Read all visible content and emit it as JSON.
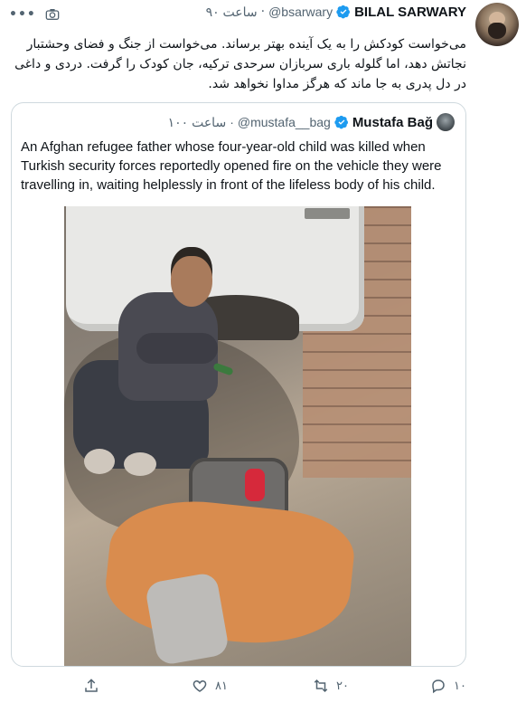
{
  "tweet": {
    "author_name": "BILAL SARWARY",
    "handle": "@bsarwary",
    "separator": "·",
    "time": "۹۰ ساعت",
    "text": "می‌خواست کودکش را به یک آینده بهتر برساند. می‌خواست از جنگ و فضای وحشتبار نجاتش دهد، اما گلوله باری سربازان سرحدی ترکیه، جان کودک را گرفت. دردی و داغی در دل پدری به جا ماند که هرگز مداوا نخواهد شد."
  },
  "quote": {
    "author_name": "Mustafa Bağ",
    "handle": "@mustafa__bag",
    "separator": "·",
    "time": "۱۰۰ ساعت",
    "text": "An Afghan refugee father whose four-year-old child was killed when Turkish security forces reportedly opened fire on the vehicle they were travelling in, waiting helplessly in front of the lifeless body of his child."
  },
  "actions": {
    "reply_count": "۱۰",
    "retweet_count": "۲۰",
    "like_count": "۸۱"
  },
  "icons": {
    "more": "more-icon",
    "camera": "camera-icon",
    "verified": "verified-icon",
    "reply": "reply-icon",
    "retweet": "retweet-icon",
    "like": "like-icon",
    "share": "share-icon"
  },
  "colors": {
    "verified": "#1d9bf0",
    "muted": "#536471",
    "border": "#cfd9de"
  }
}
